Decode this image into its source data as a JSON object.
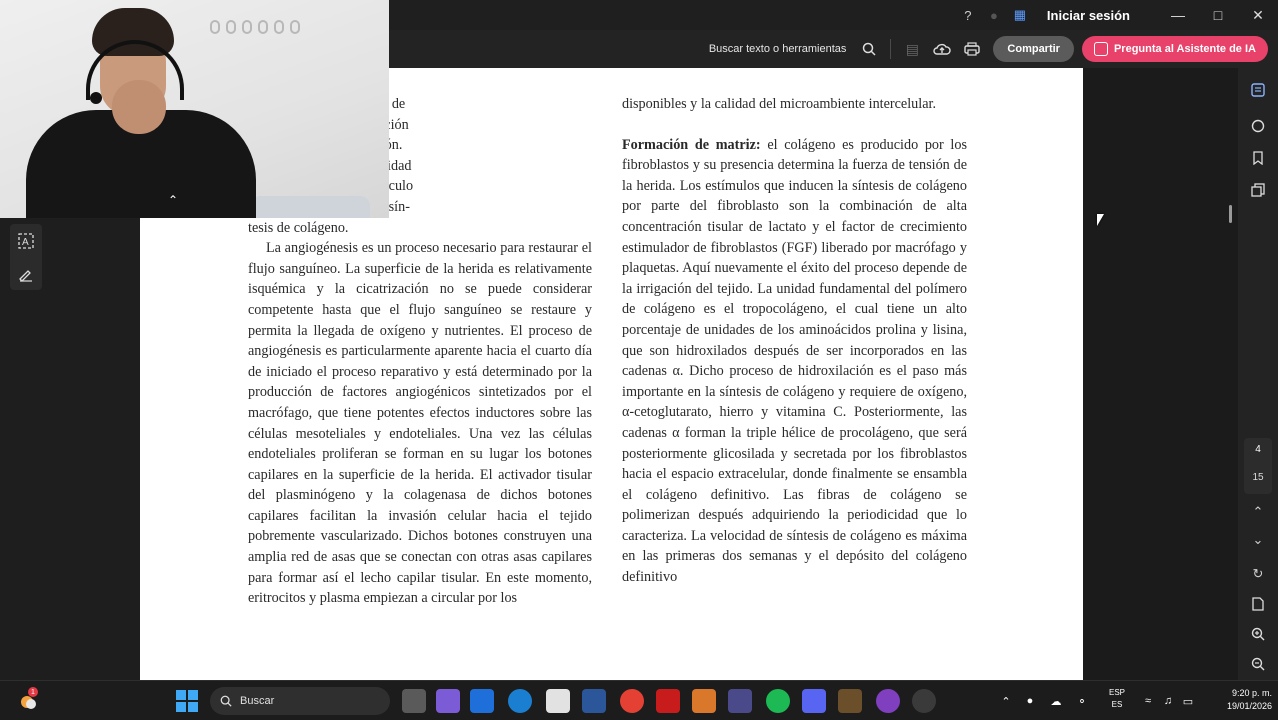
{
  "titlebar": {
    "signin_label": "Iniciar sesión",
    "icons": [
      "help-icon",
      "bell-icon",
      "apps-icon"
    ],
    "window_controls": [
      "minimize-icon",
      "maximize-icon",
      "close-icon"
    ]
  },
  "toolbar": {
    "search_label": "Buscar texto o herramientas",
    "share_label": "Compartir",
    "ai_label": "Pregunta al Asistente de IA"
  },
  "document": {
    "left_column": [
      "s. A medida que el tejido de",
      "formando, hace su aparición",
      "el proceso de cicatrización.",
      "un fibroblasto con capacidad",
      "posee un prominente retículo",
      "loso debido a una activa sín-",
      "tesis de colágeno.",
      "La angiogénesis es un proceso necesario para restaurar el flujo sanguíneo. La superficie de la herida es relativamente isquémica y la cicatrización no se puede considerar competente hasta que el flujo sanguíneo se restaure y permita la llegada de oxígeno y nutrientes. El proceso de angiogénesis es particularmente aparente hacia el cuarto día de iniciado el proceso reparativo y está determinado por la producción de factores angiogénicos sintetizados por el macrófago, que tiene potentes efectos inductores sobre las células mesoteliales y endoteliales. Una vez las células endoteliales proliferan se forman en su lugar los botones capilares en la superficie de la herida. El activador tisular del plasminógeno y la colagenasa de dichos botones capilares facilitan la invasión celular hacia el tejido pobremente vascularizado. Dichos botones construyen una amplia red de asas que se conectan con otras asas capilares para formar así el lecho capilar tisular. En este momento, eritrocitos y plasma empiezan a circular por los"
    ],
    "right_column_intro": "disponibles y la calidad del microambiente intercelular.",
    "right_column_heading": "Formación de matriz:",
    "right_column_body": " el colágeno es producido por los fibroblastos y su presencia determina la fuerza de tensión de la herida. Los estímulos que inducen la síntesis de colágeno por parte del fibroblasto son la combinación de alta concentración tisular de lactato y el factor de crecimiento estimulador de fibroblastos (FGF) liberado por macrófago y plaquetas. Aquí nuevamente el éxito del proceso depende de la irrigación del tejido. La unidad fundamental del polímero de colágeno es el tropocolágeno, el cual tiene un alto porcentaje de unidades de los aminoácidos prolina y lisina, que son hidroxilados después de ser incorporados en las cadenas α. Dicho proceso de hidroxilación es el paso más importante en la síntesis de colágeno y requiere de oxígeno, α-cetoglutarato, hierro y vitamina C. Posteriormente, las cadenas α forman la triple hélice de procolágeno, que será posteriormente glicosilada y secretada por los fibroblastos hacia el espacio extracelular, donde finalmente se ensambla el colágeno definitivo. Las fibras de colágeno se polimerizan después adquiriendo la periodicidad que lo caracteriza. La velocidad de síntesis de colágeno es máxima en las primeras dos semanas y el depósito del colágeno definitivo"
  },
  "page_nav": {
    "current_page": "4",
    "total_pages": "15"
  },
  "taskbar": {
    "search_placeholder": "Buscar",
    "weather_badge": "1",
    "lang_top": "ESP",
    "lang_bottom": "ES",
    "time": "9:20 p. m.",
    "date": "19/01/2026"
  }
}
